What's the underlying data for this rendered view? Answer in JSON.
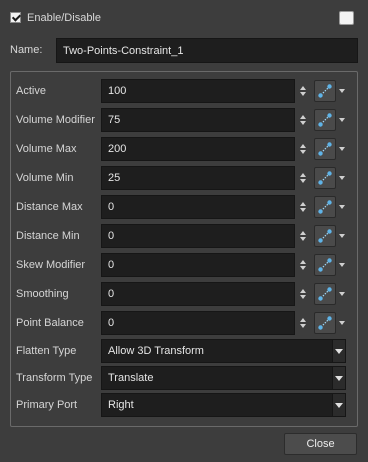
{
  "header": {
    "enable_label": "Enable/Disable",
    "enabled": true
  },
  "name": {
    "label": "Name:",
    "value": "Two-Points-Constraint_1"
  },
  "fields": [
    {
      "label": "Active",
      "value": "100"
    },
    {
      "label": "Volume Modifier",
      "value": "75"
    },
    {
      "label": "Volume Max",
      "value": "200"
    },
    {
      "label": "Volume Min",
      "value": "25"
    },
    {
      "label": "Distance Max",
      "value": "0"
    },
    {
      "label": "Distance Min",
      "value": "0"
    },
    {
      "label": "Skew Modifier",
      "value": "0"
    },
    {
      "label": "Smoothing",
      "value": "0"
    },
    {
      "label": "Point Balance",
      "value": "0"
    }
  ],
  "selects": [
    {
      "label": "Flatten Type",
      "value": "Allow 3D Transform"
    },
    {
      "label": "Transform Type",
      "value": "Translate"
    },
    {
      "label": "Primary Port",
      "value": "Right"
    }
  ],
  "footer": {
    "close_label": "Close"
  },
  "icons": {
    "function_curve": "function-curve-icon",
    "spin": "spin-arrows-icon",
    "dropdown": "chevron-down-icon"
  },
  "colors": {
    "background": "#3d3d3d",
    "field": "#1e1e1e",
    "curve_node": "#5fb4e8"
  }
}
